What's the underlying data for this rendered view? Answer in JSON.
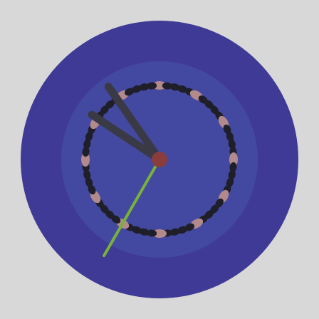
{
  "clock": {
    "time": {
      "hours": 10,
      "minutes": 50,
      "seconds": 35
    },
    "tick_count": 60,
    "colors": {
      "background": "#d8d8d8",
      "outer_dial": "#3f3a96",
      "inner_dial": "#4349a0",
      "minute_tick": "#1f1f2a",
      "hour_marker": "#b28a8c",
      "hands": "#3a3a46",
      "second_hand": "#79b23a",
      "center_cap": "#8a3d3d"
    }
  }
}
